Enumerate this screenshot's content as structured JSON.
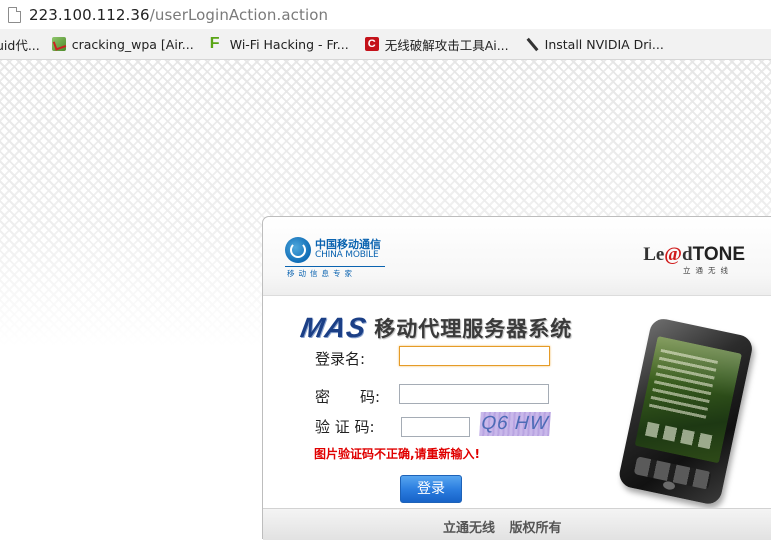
{
  "browser": {
    "url_host": "223.100.112.36",
    "url_path": "/userLoginAction.action",
    "bookmarks": [
      {
        "label": "uid代...",
        "icon": "none"
      },
      {
        "label": "cracking_wpa [Air...",
        "icon": "pencil-icon"
      },
      {
        "label": "Wi-Fi Hacking - Fr...",
        "icon": "f-logo-icon"
      },
      {
        "label": "无线破解攻击工具Ai...",
        "icon": "c-logo-icon"
      },
      {
        "label": "Install NVIDIA Dri...",
        "icon": "wrench-icon"
      }
    ]
  },
  "header": {
    "china_mobile_cn": "中国移动通信",
    "china_mobile_en": "CHINA MOBILE",
    "china_mobile_slogan": "移动信息专家",
    "leadtone_prefix": "Le",
    "leadtone_at": "@",
    "leadtone_d": "d",
    "leadtone_tone": "TONE",
    "leadtone_sub": "立通无线"
  },
  "title": {
    "mas": "MAS",
    "system_name": "移动代理服务器系统"
  },
  "form": {
    "username_label": "登录名:",
    "username_value": "",
    "password_label": "密　　码:",
    "password_value": "",
    "captcha_label": "验 证 码:",
    "captcha_value": "",
    "captcha_image_text": "Q6 HW",
    "error_message": "图片验证码不正确,请重新输入!",
    "login_button": "登录"
  },
  "footer": {
    "text": "立通无线 版权所有"
  },
  "colors": {
    "error": "#e00000",
    "button_blue": "#2c7ee0",
    "brand_blue": "#0a63b0",
    "mas_blue": "#1b3f86",
    "focus_border": "#e59b27"
  }
}
